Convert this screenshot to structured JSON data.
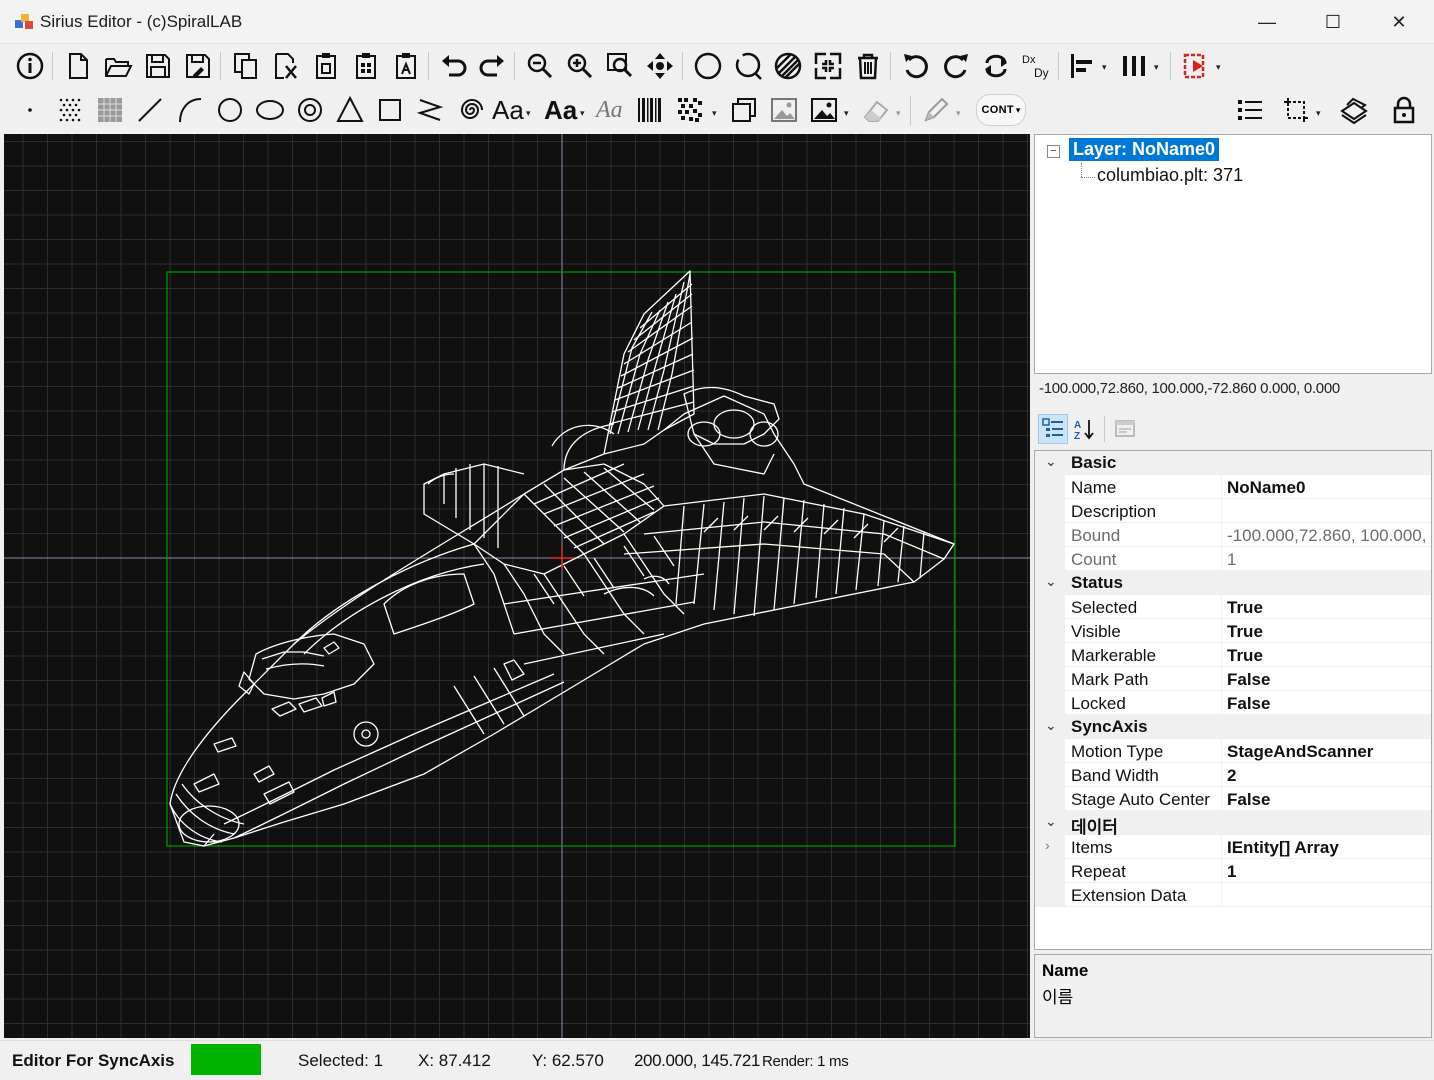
{
  "window": {
    "title": "Sirius Editor - (c)SpiralLAB",
    "minimize_glyph": "—",
    "maximize_glyph": "☐",
    "close_glyph": "✕"
  },
  "toolbar2": {
    "font_tool_1": "Aa",
    "font_tool_2": "Aa",
    "font_tool_3": "Aa",
    "dropdown_glyph": "▾",
    "cont_label": "CONT"
  },
  "tree": {
    "collapse_glyph": "⊟",
    "layer_label": "Layer: NoName0",
    "child_label": "columbiao.plt: 371"
  },
  "bounds_info": "-100.000,72.860, 100.000,-72.860   0.000, 0.000",
  "properties": {
    "categories": [
      {
        "name": "Basic",
        "chevron": "⌄",
        "rows": [
          {
            "name": "Name",
            "value": "NoName0",
            "dim": false
          },
          {
            "name": "Description",
            "value": "",
            "dim": false
          },
          {
            "name": "Bound",
            "value": "-100.000,72.860, 100.000,",
            "dim": true
          },
          {
            "name": "Count",
            "value": "1",
            "dim": true
          }
        ]
      },
      {
        "name": "Status",
        "chevron": "⌄",
        "rows": [
          {
            "name": "Selected",
            "value": "True",
            "dim": false
          },
          {
            "name": "Visible",
            "value": "True",
            "dim": false
          },
          {
            "name": "Markerable",
            "value": "True",
            "dim": false
          },
          {
            "name": "Mark Path",
            "value": "False",
            "dim": false
          },
          {
            "name": "Locked",
            "value": "False",
            "dim": false
          }
        ]
      },
      {
        "name": "SyncAxis",
        "chevron": "⌄",
        "rows": [
          {
            "name": "Motion Type",
            "value": "StageAndScanner",
            "dim": false
          },
          {
            "name": "Band Width",
            "value": "2",
            "dim": false
          },
          {
            "name": "Stage Auto Center",
            "value": "False",
            "dim": false
          }
        ]
      },
      {
        "name": "데이터",
        "chevron": "⌄",
        "rows": [
          {
            "name": "Items",
            "value": "IEntity[] Array",
            "dim": false,
            "expander": "›"
          },
          {
            "name": "Repeat",
            "value": "1",
            "dim": false
          },
          {
            "name": "Extension Data",
            "value": "",
            "dim": false
          }
        ]
      }
    ]
  },
  "help": {
    "title": "Name",
    "description": "이름"
  },
  "statusbar": {
    "editor_label": "Editor For SyncAxis",
    "status_color": "#00b400",
    "selected": "Selected: 1",
    "x": "X: 87.412",
    "y": "Y: 62.570",
    "size": "200.000, 145.721",
    "render": "Render: 1 ms"
  },
  "colors": {
    "canvas_bg": "#101010",
    "grid": "#2e2e2e",
    "axis": "#8a8aa8",
    "bound_box": "#00a000",
    "drawing": "#ffffff",
    "selection": "#0078d7"
  }
}
